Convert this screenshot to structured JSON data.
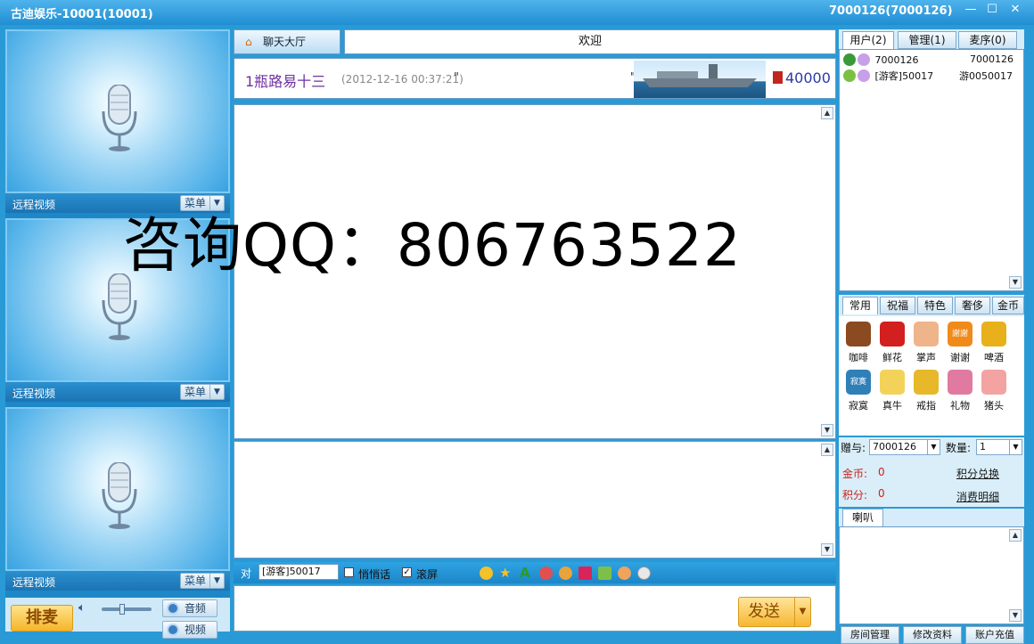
{
  "window": {
    "title": "古迪娱乐-10001(10001)",
    "user_id": "7000126(7000126)",
    "controls": [
      "—",
      "☐",
      "✕"
    ]
  },
  "video_slots": [
    {
      "label": "远程视频",
      "menu": "菜单"
    },
    {
      "label": "远程视频",
      "menu": "菜单"
    },
    {
      "label": "远程视频",
      "menu": "菜单"
    }
  ],
  "bottom_left": {
    "queue_button": "排麦",
    "audio_button": "音频",
    "video_button": "视频",
    "volume_level": 0.4
  },
  "center": {
    "hall_tab": "聊天大厅",
    "welcome": "欢迎",
    "broadcast": {
      "user": "1瓶路易十三",
      "timestamp": "(2012-12-16 00:37:21)",
      "quote": "\"",
      "quote_end": "\"",
      "score": "40000"
    }
  },
  "toolbar": {
    "to_label": "对",
    "to_value": "[游客]50017",
    "whisper_label": "悄悄话",
    "whisper_checked": false,
    "scroll_label": "滚屏",
    "scroll_checked": true
  },
  "send_button": "发送",
  "right": {
    "tabs": [
      "用户(2)",
      "管理(1)",
      "麦序(0)"
    ],
    "users": [
      {
        "name": "7000126",
        "id": "7000126"
      },
      {
        "name": "[游客]50017",
        "id": "游0050017"
      }
    ],
    "gift_tabs": [
      "常用",
      "祝福",
      "特色",
      "奢侈",
      "金币"
    ],
    "gifts": [
      {
        "name": "咖啡",
        "color": "#8b4a1f"
      },
      {
        "name": "鲜花",
        "color": "#d21f1f"
      },
      {
        "name": "掌声",
        "color": "#f0b48a"
      },
      {
        "name": "谢谢",
        "color": "#f08a1a"
      },
      {
        "name": "啤酒",
        "color": "#e8b01a"
      },
      {
        "name": "寂寞",
        "color": "#2f7fb8"
      },
      {
        "name": "真牛",
        "color": "#f3d25a"
      },
      {
        "name": "戒指",
        "color": "#e6b82a"
      },
      {
        "name": "礼物",
        "color": "#e07aa0"
      },
      {
        "name": "猪头",
        "color": "#f4a3a3"
      }
    ],
    "gift_icon_texts": [
      "謝謝",
      "寂寞"
    ],
    "give_label": "赠与:",
    "give_to": "7000126",
    "qty_label": "数量:",
    "qty_value": "1",
    "gold_label": "金币:",
    "gold_value": "0",
    "points_label": "积分:",
    "points_value": "0",
    "exchange_link": "积分兑换",
    "spend_link": "消费明细",
    "horn_tab": "喇叭",
    "bottom_tabs": [
      "房间管理",
      "修改资料",
      "账户充值"
    ]
  },
  "watermark": "咨询QQ：806763522"
}
